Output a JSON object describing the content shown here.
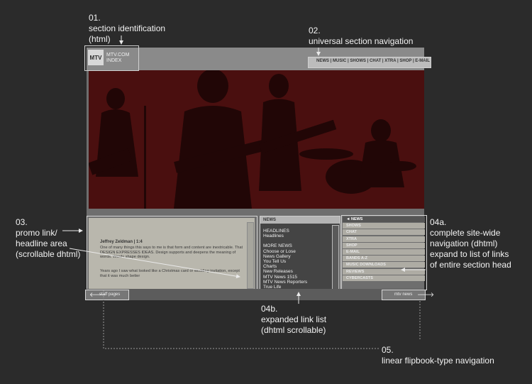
{
  "annotations": {
    "a01": {
      "num": "01.",
      "line1": "section identification",
      "line2": "(html)"
    },
    "a02": {
      "num": "02.",
      "line1": "universal section navigation"
    },
    "a03": {
      "num": "03.",
      "line1": "promo link/",
      "line2": "headline area",
      "line3": "(scrollable dhtml)"
    },
    "a04a": {
      "num": "04a.",
      "line1": "complete site-wide",
      "line2": "navigation (dhtml)",
      "line3": "expand to list of links",
      "line4": "of entire section head"
    },
    "a04b": {
      "num": "04b.",
      "line1": "expanded link list",
      "line2": "(dhtml scrollable)"
    },
    "a05": {
      "num": "05.",
      "line1": "linear flipbook-type navigation"
    }
  },
  "section_id": {
    "logo": "MTV",
    "line1": "MTV.COM",
    "line2": "INDEX"
  },
  "universal_nav": {
    "text": "NEWS | MUSIC | SHOWS | CHAT | XTRA | SHOP | E-MAIL"
  },
  "promo": {
    "author": "Jeffrey Zeldman",
    "count": "| 1:4",
    "para1": "One of many things this says to me is that form and content are inextricable. That DESIGN EXPRESSES IDEAS. Design supports and deepens the meaning of words. Words shape design.",
    "para2": "Years ago I saw what looked like a Christmas card or wedding invitation, except that it was much better"
  },
  "link_list": {
    "header": "NEWS",
    "items": [
      "HEADLINES",
      "Headlines",
      "",
      "MORE NEWS",
      "Choose or Lose",
      "News Gallery",
      "You Tell Us",
      "Charts",
      "New Releases",
      "MTV News 1515",
      "MTV News Reporters",
      "True Life"
    ]
  },
  "site_nav": {
    "items": [
      "◄ NEWS",
      "SHOWS",
      "CHAT",
      "XTRA",
      "SHOP",
      "E-MAIL",
      "BANDS A-Z",
      "MUSIC DOWNLOADS",
      "REVIEWS",
      "CYBERCASTS"
    ]
  },
  "flip": {
    "prev_label": "staff pages",
    "next_label": "mtv news"
  }
}
